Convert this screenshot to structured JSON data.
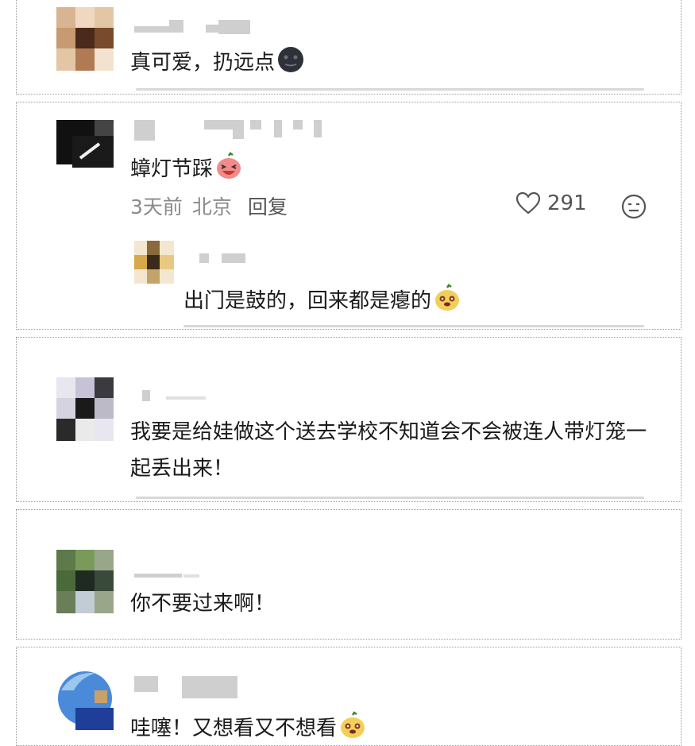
{
  "comments": [
    {
      "text": "真可爱，扔远点",
      "emoji": "new-moon-face-emoji"
    },
    {
      "text": "蟑灯节踩",
      "emoji": "laughing-fruit-emoji",
      "time": "3天前",
      "location": "北京",
      "reply_label": "回复",
      "likes": "291",
      "reply": {
        "text": "出门是鼓的，回来都是瘪的",
        "emoji": "dog-face-fruit-emoji"
      }
    },
    {
      "text": "我要是给娃做这个送去学校不知道会不会被连人带灯笼一起丢出来！"
    },
    {
      "text": "你不要过来啊！"
    },
    {
      "text": "哇噻！又想看又不想看",
      "emoji": "dog-face-fruit-emoji"
    }
  ],
  "colors": {
    "text": "#1a1a1a",
    "meta": "#8a8a8a",
    "border": "#9a9a9a"
  }
}
